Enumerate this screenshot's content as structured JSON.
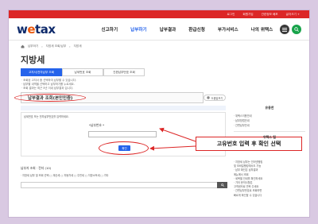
{
  "topbar": {
    "links": [
      "로그인",
      "회원가입",
      "관련정보 배포",
      "글자크기 +"
    ]
  },
  "header": {
    "logo_prefix": "w",
    "logo_mid": "e",
    "logo_suffix": "tax",
    "nav": [
      "신고하기",
      "납부하기",
      "납부결과",
      "환급신청",
      "부가서비스",
      "나의 위택스"
    ],
    "active_nav_index": 1
  },
  "breadcrumb": [
    "홈",
    "납부하기",
    "지방세 조회/납부",
    "지방세"
  ],
  "page": {
    "title": "지방세"
  },
  "tabs": [
    {
      "label": "고지서/전자납부 조회"
    },
    {
      "label": "납세번호 조회"
    },
    {
      "label": "간편납부번호 조회"
    }
  ],
  "notes": [
    "· 조회된 고지서 중 선택하여 납부할 수 있습니다.",
    "· 납부할 내역을 선택하고 납부하기를 누르세요.",
    "· 조회 결과는 최근 5년 이내 납부결과 입니다."
  ],
  "section": {
    "title": "납부결과 조회(본인인증)",
    "help_label": "도움말보기"
  },
  "notice": {
    "text": "납세번호 또는 전자납부번호를 입력하세요."
  },
  "form": {
    "field_label": "*납부번호 *",
    "field_placeholder": "",
    "confirm_label": "확인"
  },
  "callout": {
    "text": "고유번호 입력 후 확인 선택"
  },
  "sidebar": {
    "heading": "유용한",
    "links": [
      "· 위택스이용안내",
      "· 납부방법안내",
      "· 간편납부안내"
    ],
    "tips_heading": "위택스 팁",
    "tips": [
      "· 지방세 납부는 인터넷뱅킹",
      "  및 모바일뱅킹에서도 가능",
      "· 납부 확인은 납부결과",
      "  메뉴에서 조회",
      "· 세목별 안내를 확인하세요",
      "· 기타 문의사항은",
      "  고객센터로 연락 주세요",
      "· 간편납부번호로 조회하면",
      "  빠르게 확인할 수 있습니다"
    ]
  },
  "search": {
    "title": "납부자 조회 · 전자 (10)",
    "options": "· 지방세 납부 및 조회 선택  □ 재산세  □ 자동차세  □ 주민세  □ 지방소득세  □ 기타"
  },
  "colors": {
    "red_accent": "#dc2626",
    "blue_accent": "#2563eb",
    "logo_navy": "#0e2a6b",
    "logo_orange": "#ea580c",
    "page_bg": "#d9c9e2"
  },
  "icons": {
    "menu": "menu-icon",
    "search": "search-icon",
    "help": "question-circle-icon",
    "home": "home-icon"
  }
}
